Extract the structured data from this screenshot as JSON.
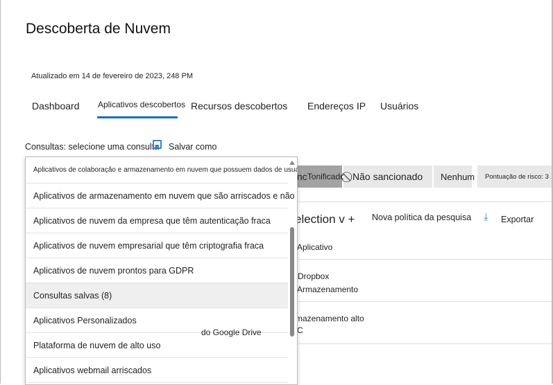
{
  "page": {
    "title": "Descoberta de Nuvem",
    "updated": "Atualizado em 14 de fevereiro de 2023, 248 PM"
  },
  "tabs": [
    {
      "label": "Dashboard"
    },
    {
      "label": "Aplicativos descobertos"
    },
    {
      "label": "Recursos descobertos"
    },
    {
      "label": "Endereços IP"
    },
    {
      "label": "Usuários"
    }
  ],
  "queries": {
    "label": "Consultas: selecione uma consulta",
    "save_as": "Salvar como",
    "items": [
      "Aplicativos de colaboração e armazenamento em nuvem que possuem dados de usuário",
      "Aplicativos de armazenamento em nuvem que são arriscados e não compatíveis",
      "Aplicativos de nuvem da empresa que têm autenticação fraca",
      "Aplicativos de nuvem empresarial que têm criptografia fraca",
      "Aplicativos de nuvem prontos para GDPR",
      "Consultas salvas (8)",
      "Aplicativos Personalizados",
      "Plataforma de nuvem de alto uso",
      "Aplicativos webmail arriscados"
    ],
    "highlighted": "Consultas salvas (8)"
  },
  "filters": {
    "first_partial": "nc",
    "tonificado": "Tonificado",
    "unsanctioned": "Não sancionado",
    "none": "Nenhum",
    "risk": "Pontuação de risco: 3"
  },
  "toolbar": {
    "selection": "election v +",
    "new_policy": "Nova política da pesquisa",
    "export": "Exportar"
  },
  "table": {
    "header": "Aplicativo",
    "rows": [
      {
        "name": "Dropbox",
        "category": "Armazenamento"
      },
      {
        "name": "Armazenamento alto",
        "category": "C"
      }
    ],
    "overlay_text": "do Google Drive"
  }
}
